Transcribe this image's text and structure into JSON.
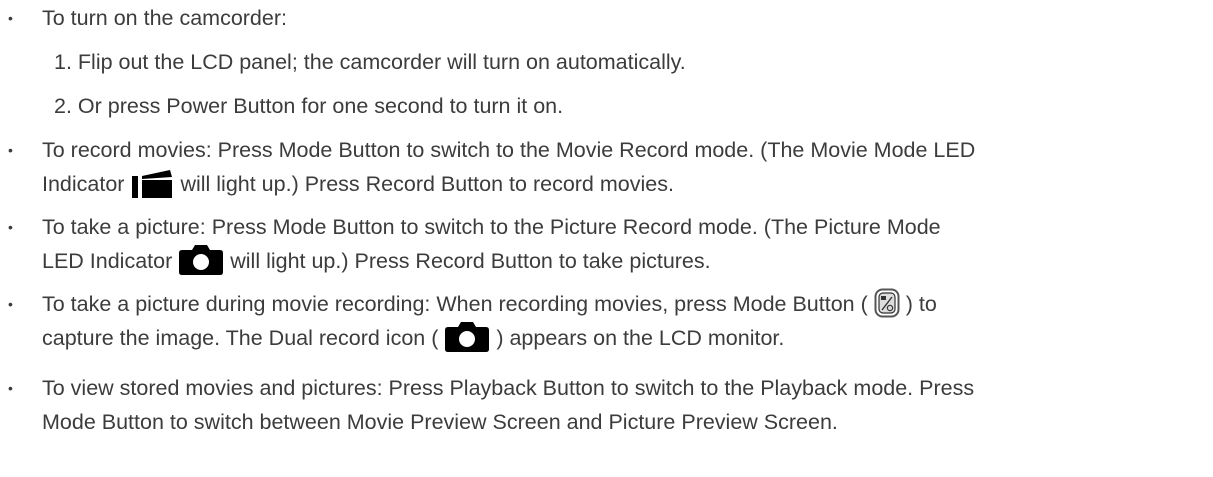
{
  "bullets": [
    {
      "text": "To turn on the camcorder:",
      "steps": [
        "1.  Flip out the LCD panel; the camcorder will turn on automatically.",
        "2.  Or press Power Button for one second to turn it on."
      ]
    },
    {
      "line1": "To record movies: Press Mode Button to switch to the Movie Record mode. (The Movie Mode LED",
      "line2_before": "Indicator",
      "line2_after": "will light up.) Press Record Button to record movies."
    },
    {
      "line1": "To take a picture: Press Mode Button to switch to the Picture Record mode. (The Picture Mode",
      "line2_before": "LED Indicator",
      "line2_after": "will light up.) Press Record Button to take pictures."
    },
    {
      "line1_before": "To take a picture during movie recording: When recording movies, press Mode Button (",
      "line1_after": ") to",
      "line2_before": "capture the image. The Dual record icon (",
      "line2_after": ") appears on the LCD monitor."
    },
    {
      "line1": "To view stored movies and pictures: Press Playback Button to switch to the Playback mode. Press",
      "line2": "Mode Button to switch between Movie Preview Screen and Picture Preview Screen."
    }
  ],
  "icons": {
    "movie_led": "movie-camera-icon",
    "picture_led": "camera-icon",
    "mode_button": "mode-button-icon",
    "dual_record": "camera-icon"
  },
  "colors": {
    "text": "#3c3c3c",
    "icon": "#000000"
  }
}
